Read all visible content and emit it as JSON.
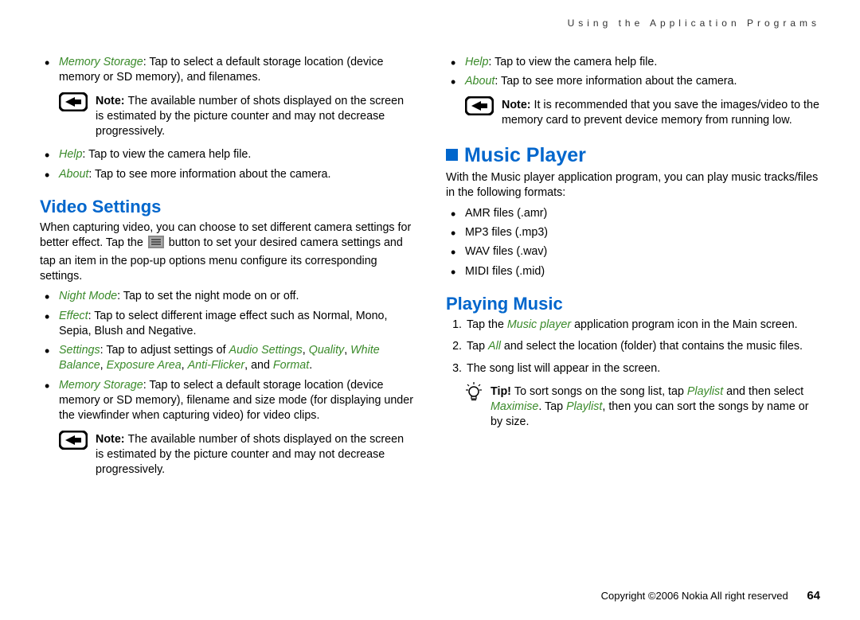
{
  "header": {
    "chapter_title": "Using the Application Programs"
  },
  "left": {
    "bullets_top": [
      {
        "term": "Memory Storage",
        "text": ": Tap to select a default storage location (device memory or SD memory), and filenames."
      }
    ],
    "note1": {
      "label": "Note: ",
      "text": "The available number of shots displayed on the screen is estimated by the picture counter and may not decrease progressively."
    },
    "bullets_mid": [
      {
        "term": "Help",
        "text": ": Tap to view the camera help file."
      },
      {
        "term": "About",
        "text": ": Tap to see more information about the camera."
      }
    ],
    "video_heading": "Video Settings",
    "video_para_a": "When capturing video, you can choose to set different camera settings for better effect. Tap the ",
    "video_para_b": " button to set your desired camera settings and tap an item in the pop-up options menu configure its corresponding settings.",
    "video_bullets": [
      {
        "term": "Night Mode",
        "text": ": Tap to set the night mode on or off."
      },
      {
        "term": "Effect",
        "text": ": Tap to select different image effect such as Normal, Mono, Sepia, Blush and Negative."
      },
      {
        "prefix": "Settings",
        "mid": ": Tap to adjust settings of ",
        "terms": [
          "Audio Settings",
          "Quality",
          "White Balance",
          "Exposure Area",
          "Anti-Flicker"
        ],
        "and": ", and ",
        "last": "Format",
        "suffix": "."
      },
      {
        "term": "Memory Storage",
        "text": ": Tap to select a default storage location (device memory or SD memory), filename and size mode (for displaying under the viewfinder when capturing video) for video clips."
      }
    ],
    "note2": {
      "label": "Note: ",
      "text": "The available number of shots displayed on the screen is estimated by the picture counter and may not decrease progressively."
    }
  },
  "right": {
    "bullets_top": [
      {
        "term": "Help",
        "text": ": Tap to view the camera help file."
      },
      {
        "term": "About",
        "text": ": Tap to see more information about the camera."
      }
    ],
    "note1": {
      "label": "Note: ",
      "text": "It is recommended that you save the images/video to the memory card to prevent device memory from running low."
    },
    "music_heading": "Music Player",
    "music_para": "With the Music player application program, you can play music tracks/files in the following formats:",
    "formats": [
      "AMR files (.amr)",
      "MP3 files (.mp3)",
      "WAV files (.wav)",
      "MIDI files (.mid)"
    ],
    "playing_heading": "Playing Music",
    "steps": [
      {
        "a": "Tap the ",
        "term": "Music player",
        "b": " application program icon in the Main screen."
      },
      {
        "a": "Tap ",
        "term": "All",
        "b": " and select the location (folder) that contains the music files."
      },
      {
        "a": "The song list will appear in the screen."
      }
    ],
    "tip": {
      "label": "Tip! ",
      "a": "To sort songs on the song list, tap ",
      "t1": "Playlist",
      "b": " and then select ",
      "t2": "Maximise",
      "c": ". Tap ",
      "t3": "Playlist",
      "d": ", then you can sort the songs by name or by size."
    }
  },
  "footer": {
    "copyright": "Copyright ©2006 Nokia All right reserved",
    "page": "64"
  }
}
